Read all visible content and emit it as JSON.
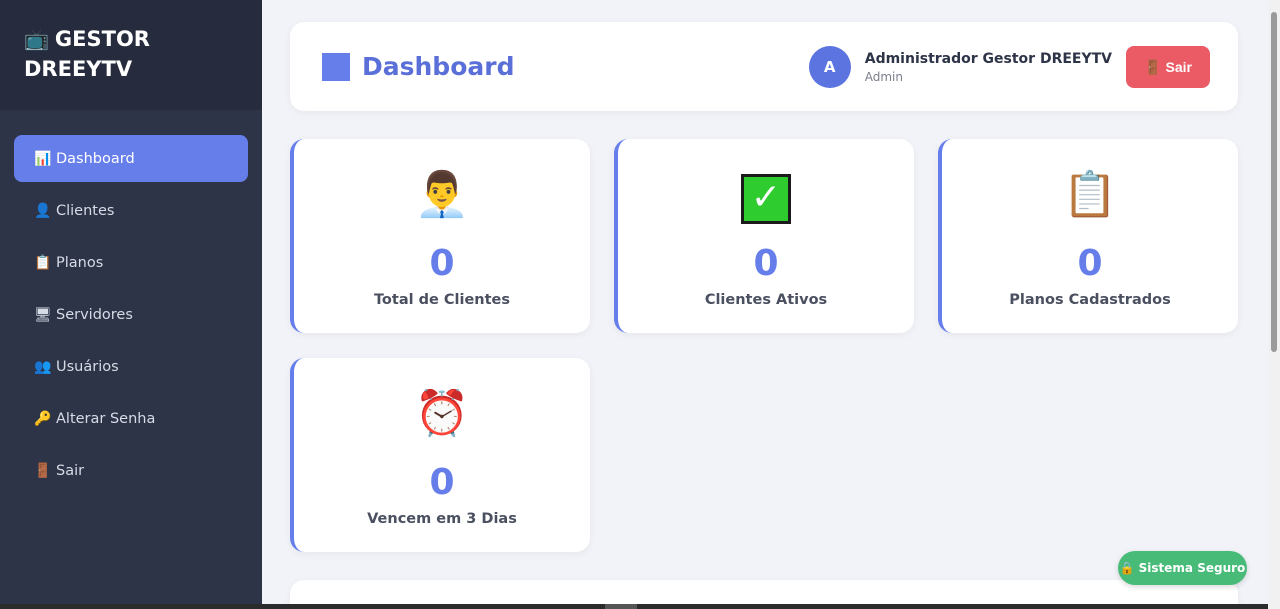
{
  "brand": {
    "icon": "📺",
    "line1": "GESTOR",
    "line2": "DREEYTV"
  },
  "sidebar": {
    "items": [
      {
        "icon": "📊",
        "label": "Dashboard",
        "active": true
      },
      {
        "icon": "👤",
        "label": "Clientes"
      },
      {
        "icon": "📋",
        "label": "Planos"
      },
      {
        "icon": "🖥",
        "label": "Servidores"
      },
      {
        "icon": "👥",
        "label": "Usuários"
      },
      {
        "icon": "🔑",
        "label": "Alterar Senha"
      },
      {
        "icon": "🚪",
        "label": "Sair"
      }
    ]
  },
  "header": {
    "title": "Dashboard",
    "avatar_letter": "A",
    "user_name": "Administrador Gestor DREEYTV",
    "user_role": "Admin",
    "logout_icon": "🚪",
    "logout_label": "Sair"
  },
  "stats": [
    {
      "icon": "👨‍💼",
      "value": "0",
      "label": "Total de Clientes"
    },
    {
      "icon": "✓",
      "value": "0",
      "label": "Clientes Ativos"
    },
    {
      "icon": "📋",
      "value": "0",
      "label": "Planos Cadastrados"
    },
    {
      "icon": "⏰",
      "value": "0",
      "label": "Vencem em 3 Dias"
    }
  ],
  "badge": {
    "icon": "🔒",
    "label": "Sistema Seguro"
  },
  "colors": {
    "accent": "#667eea",
    "sidebar": "#2d3447",
    "danger": "#ea5b66",
    "success": "#48bb78"
  }
}
